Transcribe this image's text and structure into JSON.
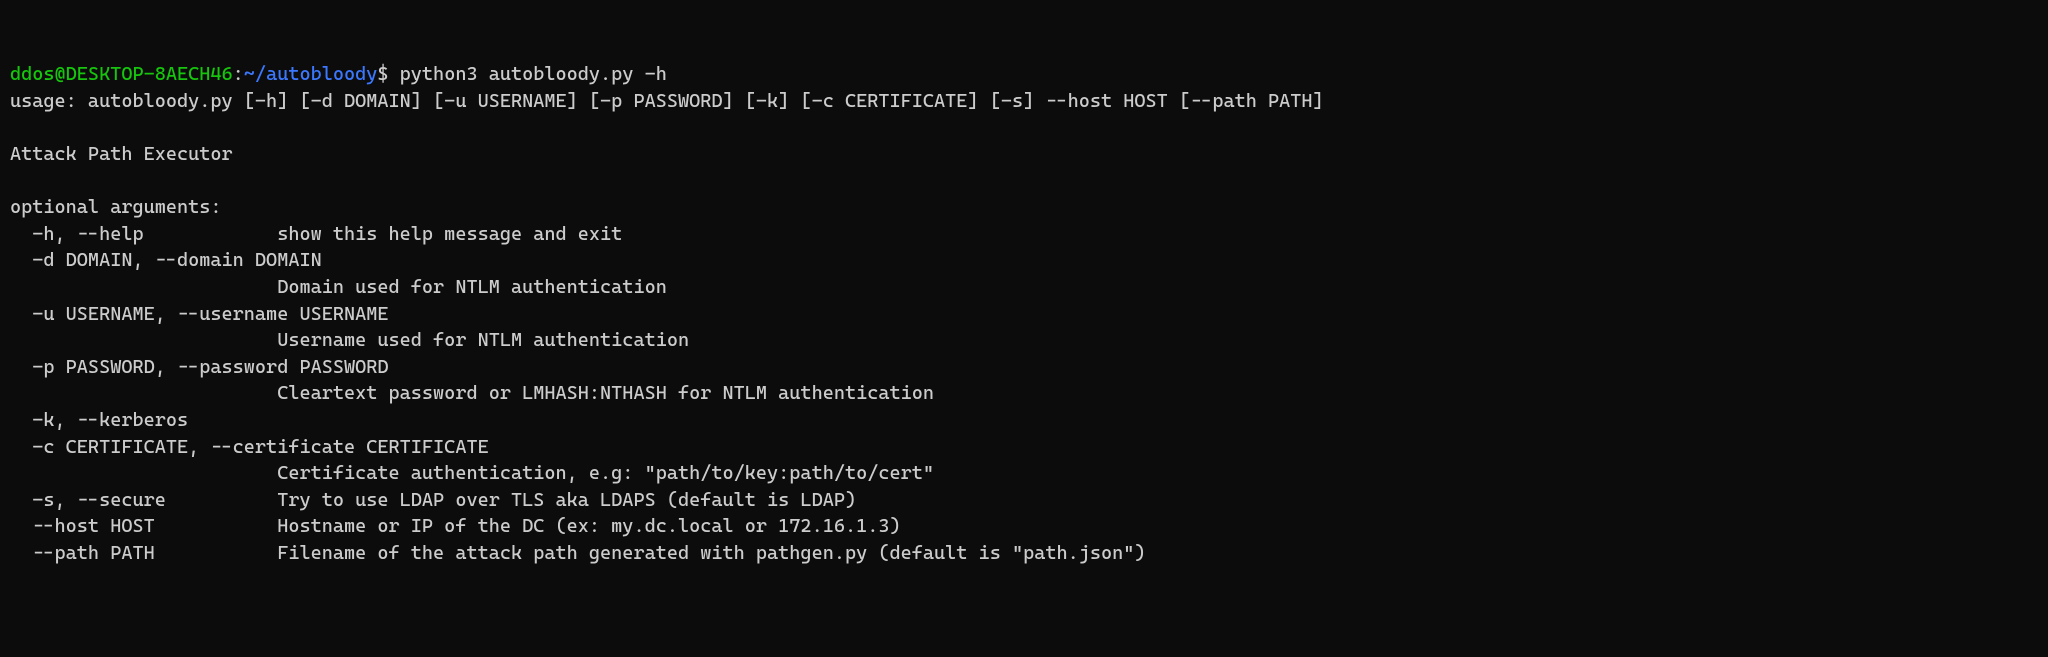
{
  "prompt": {
    "user": "ddos@DESKTOP-8AECH46",
    "sep": ":",
    "path": "~/autobloody",
    "dollar": "$ "
  },
  "command": "python3 autobloody.py -h",
  "usage": "usage: autobloody.py [-h] [-d DOMAIN] [-u USERNAME] [-p PASSWORD] [-k] [-c CERTIFICATE] [-s] --host HOST [--path PATH]",
  "blank1": "",
  "description": "Attack Path Executor",
  "blank2": "",
  "optional_header": "optional arguments:",
  "args": {
    "help": "  -h, --help            show this help message and exit",
    "domain1": "  -d DOMAIN, --domain DOMAIN",
    "domain2": "                        Domain used for NTLM authentication",
    "user1": "  -u USERNAME, --username USERNAME",
    "user2": "                        Username used for NTLM authentication",
    "pass1": "  -p PASSWORD, --password PASSWORD",
    "pass2": "                        Cleartext password or LMHASH:NTHASH for NTLM authentication",
    "kerberos": "  -k, --kerberos",
    "cert1": "  -c CERTIFICATE, --certificate CERTIFICATE",
    "cert2": "                        Certificate authentication, e.g: \"path/to/key:path/to/cert\"",
    "secure": "  -s, --secure          Try to use LDAP over TLS aka LDAPS (default is LDAP)",
    "host": "  --host HOST           Hostname or IP of the DC (ex: my.dc.local or 172.16.1.3)",
    "path": "  --path PATH           Filename of the attack path generated with pathgen.py (default is \"path.json\")"
  }
}
